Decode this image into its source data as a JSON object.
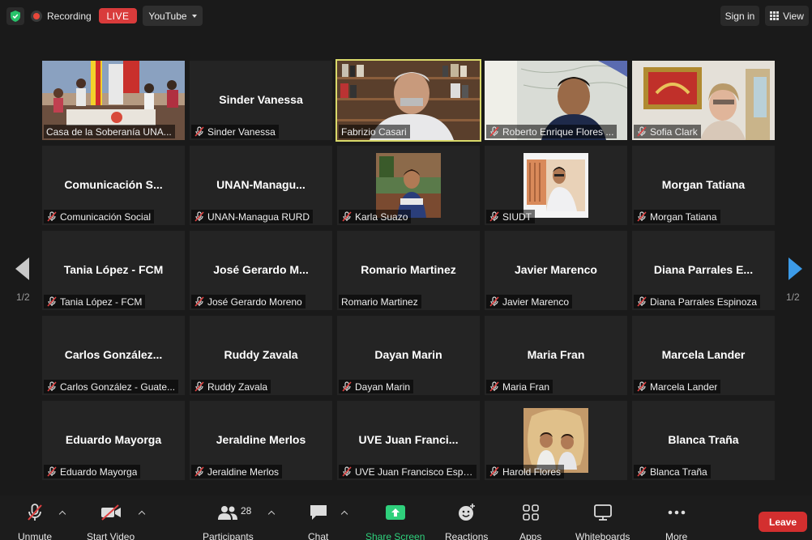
{
  "header": {
    "recording_label": "Recording",
    "live_label": "LIVE",
    "stream_target": "YouTube",
    "signin_label": "Sign in",
    "view_label": "View"
  },
  "pagination": {
    "left": "1/2",
    "right": "1/2"
  },
  "tiles": [
    {
      "name": "",
      "label": "Casa de la Soberanía UNA...",
      "muted": false,
      "video": "group-room"
    },
    {
      "name": "Sinder Vanessa",
      "label": "Sinder Vanessa",
      "muted": true
    },
    {
      "name": "",
      "label": "Fabrizio Casari",
      "muted": false,
      "video": "man-bookshelf",
      "active": true
    },
    {
      "name": "",
      "label": "Roberto Enrique Flores ...",
      "muted": true,
      "video": "man-map"
    },
    {
      "name": "",
      "label": "Sofia Clark",
      "muted": true,
      "video": "woman-room"
    },
    {
      "name": "Comunicación  S...",
      "label": "Comunicación Social",
      "muted": true
    },
    {
      "name": "UNAN-Managu...",
      "label": "UNAN-Managua RURD",
      "muted": true
    },
    {
      "name": "",
      "label": "Karla Suazo",
      "muted": true,
      "photo": "woman-photo"
    },
    {
      "name": "",
      "label": "SIUDT",
      "muted": true,
      "photo": "man-photo"
    },
    {
      "name": "Morgan Tatiana",
      "label": "Morgan Tatiana",
      "muted": true
    },
    {
      "name": "Tania López - FCM",
      "label": "Tania López - FCM",
      "muted": true
    },
    {
      "name": "José Gerardo M...",
      "label": "José Gerardo Moreno",
      "muted": true
    },
    {
      "name": "Romario Martinez",
      "label": "Romario Martinez",
      "muted": false
    },
    {
      "name": "Javier Marenco",
      "label": "Javier Marenco",
      "muted": true
    },
    {
      "name": "Diana  Parrales  E...",
      "label": "Diana Parrales Espinoza",
      "muted": true
    },
    {
      "name": "Carlos  González...",
      "label": "Carlos González - Guate...",
      "muted": true
    },
    {
      "name": "Ruddy Zavala",
      "label": "Ruddy Zavala",
      "muted": true
    },
    {
      "name": "Dayan Marin",
      "label": "Dayan Marin",
      "muted": true
    },
    {
      "name": "Maria Fran",
      "label": "Maria Fran",
      "muted": true
    },
    {
      "name": "Marcela Lander",
      "label": "Marcela Lander",
      "muted": true
    },
    {
      "name": "Eduardo Mayorga",
      "label": "Eduardo Mayorga",
      "muted": true
    },
    {
      "name": "Jeraldine Merlos",
      "label": "Jeraldine Merlos",
      "muted": true
    },
    {
      "name": "UVE  Juan  Franci...",
      "label": "UVE Juan Francisco Espi...",
      "muted": true
    },
    {
      "name": "",
      "label": "Harold Flores",
      "muted": true,
      "photo": "kids-photo"
    },
    {
      "name": "Blanca Traña",
      "label": "Blanca Traña",
      "muted": true
    }
  ],
  "toolbar": {
    "unmute": "Unmute",
    "start_video": "Start Video",
    "participants": "Participants",
    "participant_count": "28",
    "chat": "Chat",
    "share_screen": "Share Screen",
    "reactions": "Reactions",
    "apps": "Apps",
    "whiteboards": "Whiteboards",
    "more": "More",
    "leave": "Leave"
  },
  "colors": {
    "background": "#1a1a1a",
    "tile": "#242424",
    "live": "#d93b3b",
    "active_speaker": "#d9d96a",
    "share_green": "#2fd07c",
    "leave": "#d32f2f",
    "next_arrow": "#3c9be8"
  }
}
